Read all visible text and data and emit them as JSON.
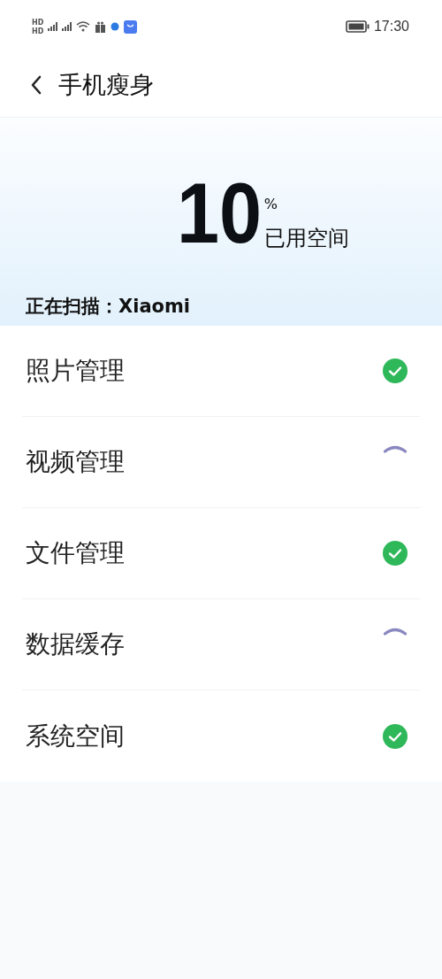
{
  "status_bar": {
    "sim_labels": [
      "HD",
      "HD"
    ],
    "time": "17:30"
  },
  "header": {
    "title": "手机瘦身"
  },
  "usage": {
    "value": "10",
    "unit": "%",
    "caption": "已用空间"
  },
  "scan": {
    "label": "正在扫描：Xiaomi"
  },
  "items": [
    {
      "label": "照片管理",
      "done": true
    },
    {
      "label": "视频管理",
      "done": false
    },
    {
      "label": "文件管理",
      "done": true
    },
    {
      "label": "数据缓存",
      "done": false
    },
    {
      "label": "系统空间",
      "done": true
    }
  ]
}
